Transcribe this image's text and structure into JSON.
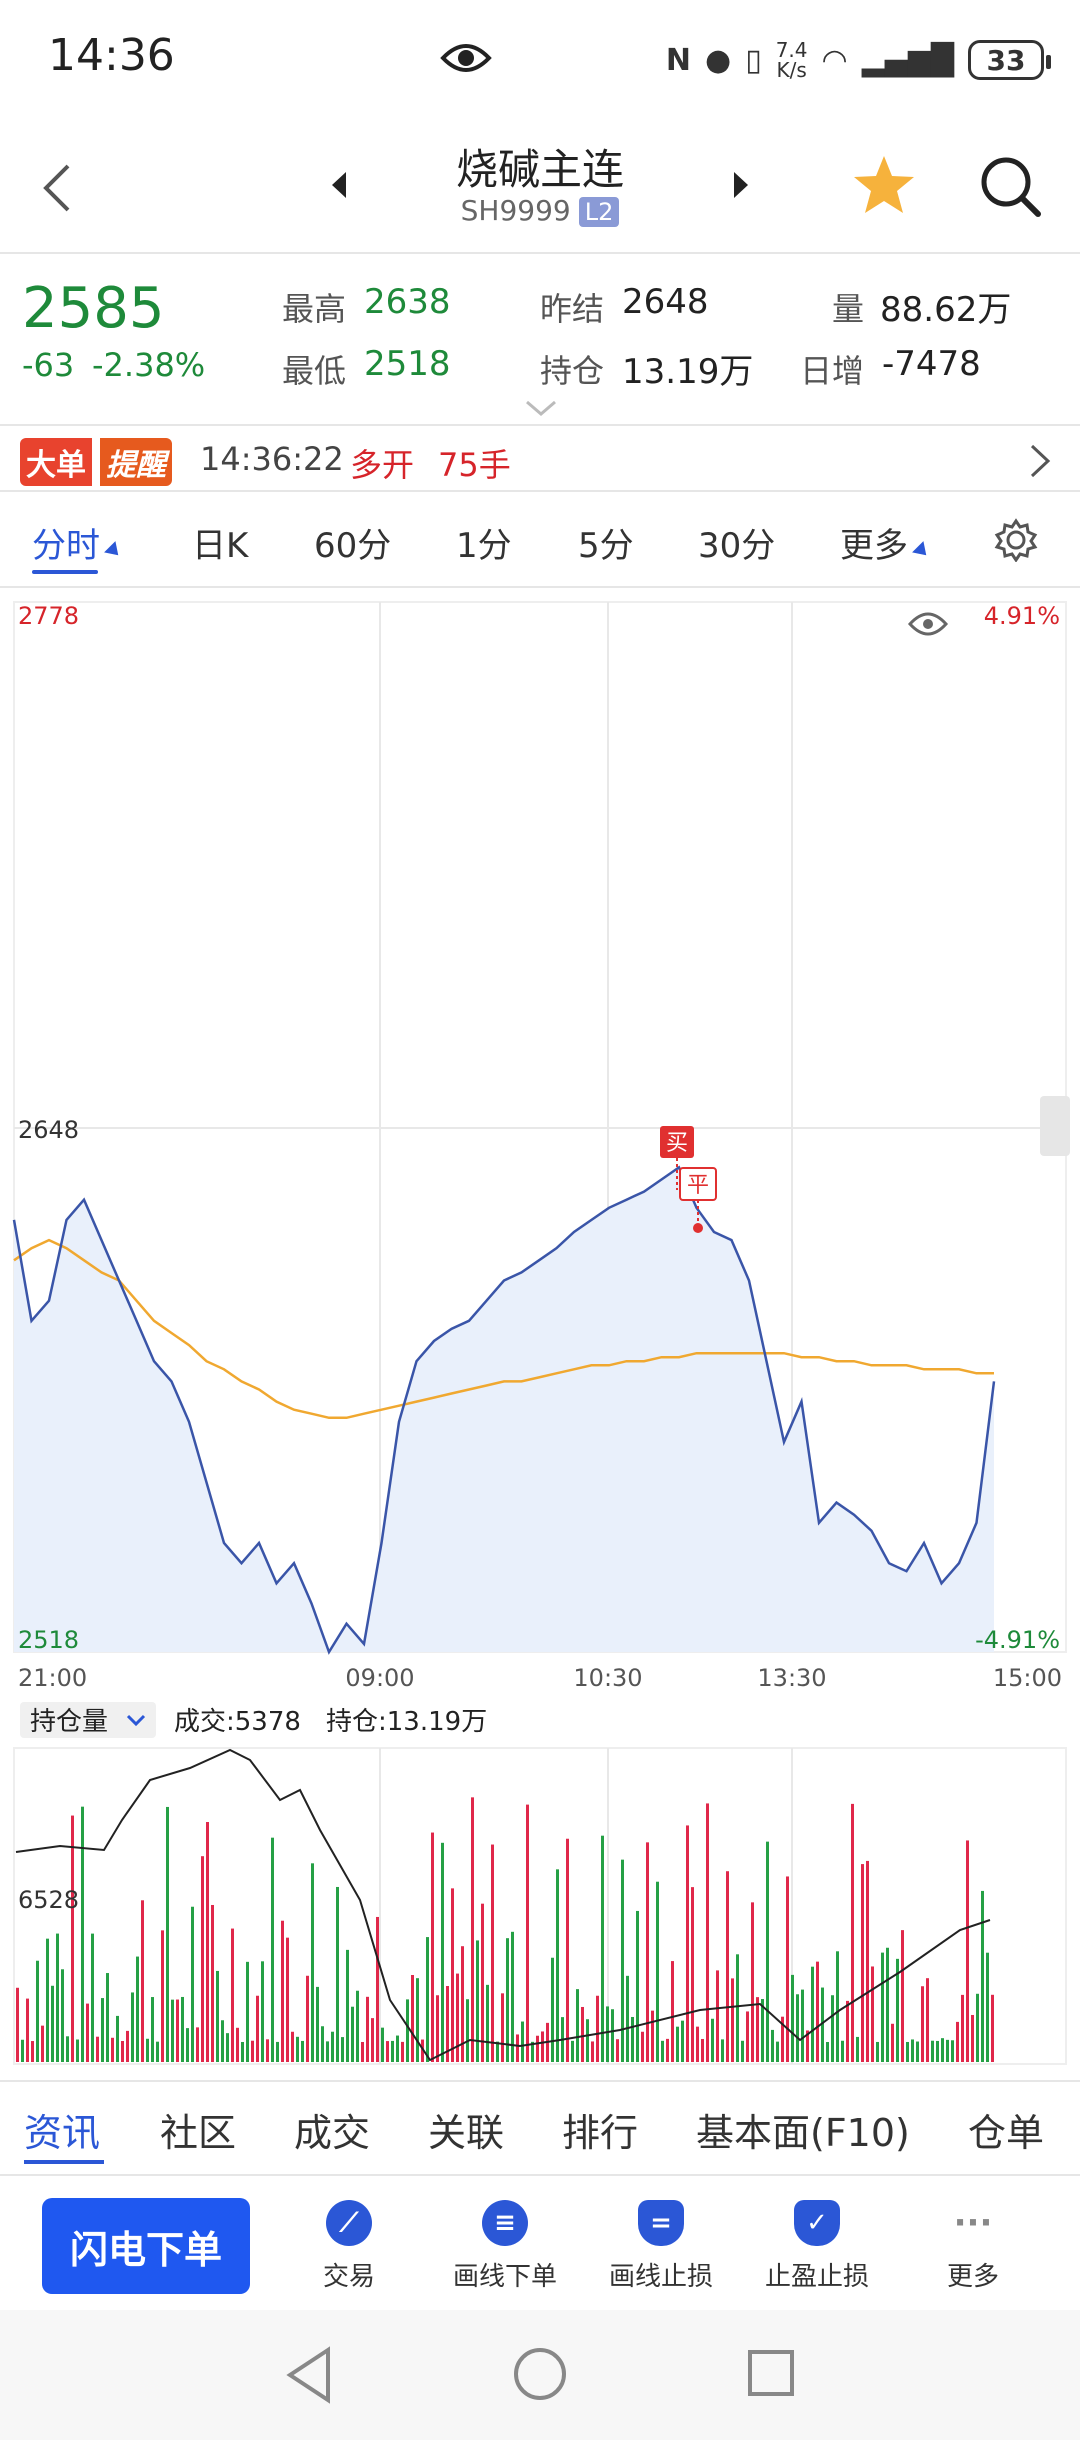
{
  "status_bar": {
    "time": "14:36",
    "net_speed_top": "7.4",
    "net_speed_unit": "K/s",
    "battery": "33"
  },
  "header": {
    "title": "烧碱主连",
    "code": "SH9999",
    "badge": "L2"
  },
  "quote": {
    "price": "2585",
    "change": "-63",
    "change_pct": "-2.38%",
    "high_label": "最高",
    "high": "2638",
    "low_label": "最低",
    "low": "2518",
    "prev_settle_label": "昨结",
    "prev_settle": "2648",
    "oi_label": "持仓",
    "oi": "13.19万",
    "volume_label": "量",
    "volume": "88.62万",
    "daily_inc_label": "日增",
    "daily_inc": "-7478"
  },
  "big_order": {
    "tag_left": "大单",
    "tag_right": "提醒",
    "time": "14:36:22",
    "type": "多开",
    "amount": "75手"
  },
  "tabs": [
    {
      "label": "分时",
      "active": true
    },
    {
      "label": "日K"
    },
    {
      "label": "60分"
    },
    {
      "label": "1分"
    },
    {
      "label": "5分"
    },
    {
      "label": "30分"
    },
    {
      "label": "更多"
    }
  ],
  "chart_labels": {
    "top_price": "2778",
    "top_pct": "4.91%",
    "mid_price": "2648",
    "bottom_price": "2518",
    "bottom_pct": "-4.91%",
    "x_ticks": [
      "21:00",
      "09:00",
      "10:30",
      "13:30",
      "15:00"
    ],
    "buy_marker": "买",
    "close_marker": "平",
    "sub_selector": "持仓量",
    "sub_volume": "成交:5378",
    "sub_oi": "持仓:13.19万",
    "sub_level": "6528"
  },
  "chart_data": {
    "type": "line",
    "title": "",
    "ylim": [
      2518,
      2778
    ],
    "reference": 2648,
    "x_ticks": [
      "21:00",
      "09:00",
      "10:30",
      "13:30",
      "15:00"
    ],
    "series": [
      {
        "name": "",
        "values": [
          2625,
          2600,
          2605,
          2625,
          2630,
          2620,
          2610,
          2600,
          2590,
          2585,
          2575,
          2560,
          2545,
          2540,
          2545,
          2535,
          2540,
          2530,
          2518,
          2525,
          2520,
          2545,
          2575,
          2590,
          2595,
          2598,
          2600,
          2605,
          2610,
          2612,
          2615,
          2618,
          2622,
          2625,
          2628,
          2630,
          2632,
          2635,
          2638,
          2628,
          2622,
          2620,
          2610,
          2590,
          2570,
          2580,
          2550,
          2555,
          2552,
          2548,
          2540,
          2538,
          2545,
          2535,
          2540,
          2550,
          2585
        ]
      },
      {
        "name": "",
        "values": [
          2615,
          2618,
          2620,
          2618,
          2615,
          2612,
          2610,
          2605,
          2600,
          2597,
          2594,
          2590,
          2588,
          2585,
          2583,
          2580,
          2578,
          2577,
          2576,
          2576,
          2577,
          2578,
          2579,
          2580,
          2581,
          2582,
          2583,
          2584,
          2585,
          2585,
          2586,
          2587,
          2588,
          2589,
          2589,
          2590,
          2590,
          2591,
          2591,
          2592,
          2592,
          2592,
          2592,
          2592,
          2592,
          2591,
          2591,
          2590,
          2590,
          2589,
          2589,
          2589,
          2588,
          2588,
          2588,
          2587,
          2587
        ]
      }
    ]
  },
  "bottom_nav": [
    "资讯",
    "社区",
    "成交",
    "关联",
    "排行",
    "基本面(F10)",
    "仓单"
  ],
  "actions": {
    "flash_order": "闪电下单",
    "items": [
      "交易",
      "画线下单",
      "画线止损",
      "止盈止损",
      "更多"
    ]
  },
  "colors": {
    "up": "#d6242a",
    "down": "#1e8a3a",
    "accent": "#2b57d6",
    "price_line": "#3a55a8",
    "avg_line": "#f0a830"
  }
}
